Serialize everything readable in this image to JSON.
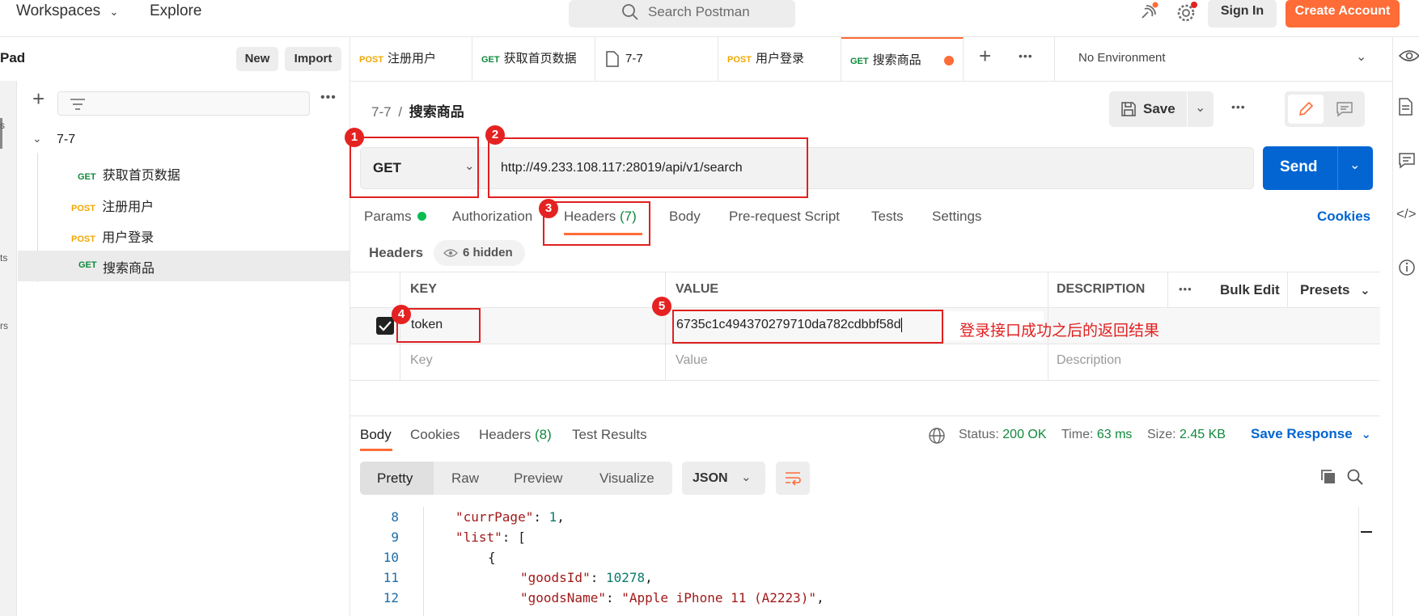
{
  "topbar": {
    "workspaces": "Workspaces",
    "explore": "Explore",
    "search_placeholder": "Search Postman",
    "sign_in": "Sign In",
    "create_account": "Create Account"
  },
  "sidebar": {
    "title": "Pad",
    "new_label": "New",
    "import_label": "Import",
    "rail_fragments": [
      "s",
      "ts",
      "rs"
    ],
    "collection": "7-7",
    "items": [
      {
        "method": "GET",
        "label": "获取首页数据"
      },
      {
        "method": "POST",
        "label": "注册用户"
      },
      {
        "method": "POST",
        "label": "用户登录"
      },
      {
        "method": "GET",
        "label": "搜索商品"
      }
    ]
  },
  "tabs": [
    {
      "method": "POST",
      "label": "注册用户"
    },
    {
      "method": "GET",
      "label": "获取首页数据"
    },
    {
      "method": "",
      "label": "7-7"
    },
    {
      "method": "POST",
      "label": "用户登录"
    },
    {
      "method": "GET",
      "label": "搜索商品"
    }
  ],
  "environment": "No Environment",
  "breadcrumb": {
    "parent": "7-7",
    "sep": "/",
    "current": "搜索商品"
  },
  "save_label": "Save",
  "request": {
    "method": "GET",
    "url": "http://49.233.108.117:28019/api/v1/search",
    "send_label": "Send"
  },
  "request_tabs": {
    "params": "Params",
    "authorization": "Authorization",
    "headers": "Headers",
    "headers_count": "(7)",
    "body": "Body",
    "prerequest": "Pre-request Script",
    "tests": "Tests",
    "settings": "Settings",
    "cookies": "Cookies"
  },
  "headers_section": {
    "title": "Headers",
    "hidden": "6 hidden"
  },
  "headers_table": {
    "col_key": "KEY",
    "col_value": "VALUE",
    "col_description": "DESCRIPTION",
    "bulk_edit": "Bulk Edit",
    "presets": "Presets",
    "row": {
      "key": "token",
      "value": "6735c1c494370279710da782cdbbf58d"
    },
    "placeholder_key": "Key",
    "placeholder_value": "Value",
    "placeholder_description": "Description"
  },
  "annotation_note": "登录接口成功之后的返回结果",
  "annotations": [
    "1",
    "2",
    "3",
    "4",
    "5"
  ],
  "response_tabs": {
    "body": "Body",
    "cookies": "Cookies",
    "headers": "Headers",
    "headers_count": "(8)",
    "test_results": "Test Results"
  },
  "response_status": {
    "status_label": "Status:",
    "status": "200 OK",
    "time_label": "Time:",
    "time": "63 ms",
    "size_label": "Size:",
    "size": "2.45 KB",
    "save_response": "Save Response"
  },
  "view_modes": {
    "pretty": "Pretty",
    "raw": "Raw",
    "preview": "Preview",
    "visualize": "Visualize",
    "format": "JSON"
  },
  "code_lines": [
    {
      "n": "8",
      "indent": 1,
      "key": "\"currPage\"",
      "sep": ": ",
      "val": "1",
      "type": "num",
      "tail": ","
    },
    {
      "n": "9",
      "indent": 1,
      "key": "\"list\"",
      "sep": ": ",
      "val": "[",
      "type": "punc",
      "tail": ""
    },
    {
      "n": "10",
      "indent": 2,
      "key": "",
      "sep": "",
      "val": "{",
      "type": "punc",
      "tail": ""
    },
    {
      "n": "11",
      "indent": 3,
      "key": "\"goodsId\"",
      "sep": ": ",
      "val": "10278",
      "type": "num",
      "tail": ","
    },
    {
      "n": "12",
      "indent": 3,
      "key": "\"goodsName\"",
      "sep": ": ",
      "val": "\"Apple iPhone 11 (A2223)\"",
      "type": "str",
      "tail": ","
    }
  ],
  "colors": {
    "accent": "#ff6c37",
    "send": "#0265d2",
    "success": "#0f8a3c",
    "annotation": "#e02020"
  }
}
